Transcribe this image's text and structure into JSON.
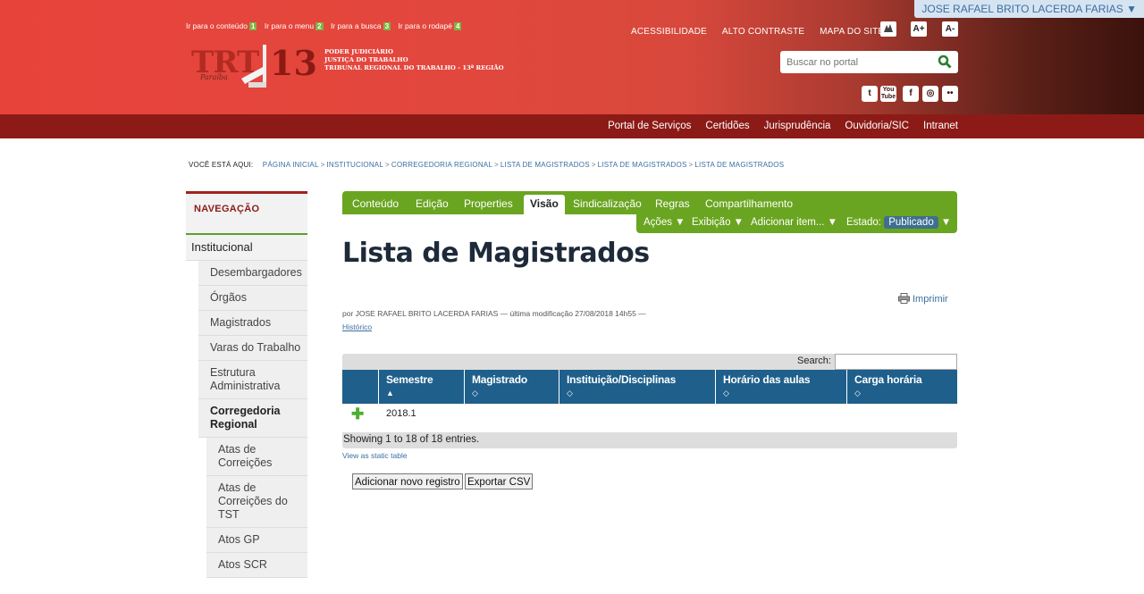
{
  "user": {
    "name": "JOSE RAFAEL BRITO LACERDA FARIAS ▼"
  },
  "skip_links": [
    {
      "label": "Ir para o conteúdo",
      "key": "1"
    },
    {
      "label": "Ir para o menu",
      "key": "2"
    },
    {
      "label": "Ir para a busca",
      "key": "3"
    },
    {
      "label": "Ir para o rodapé",
      "key": "4"
    }
  ],
  "logo": {
    "text": "TRT",
    "number": "13",
    "subtitle": "Paraíba"
  },
  "institution": [
    "PODER JUDICIÁRIO",
    "JUSTIÇA DO TRABALHO",
    "TRIBUNAL REGIONAL DO TRABALHO - 13ª REGIÃO"
  ],
  "top_links": [
    "ACESSIBILIDADE",
    "ALTO CONTRASTE",
    "MAPA DO SITE"
  ],
  "font_buttons": [
    "A+",
    "A-"
  ],
  "search": {
    "placeholder": "Buscar no portal"
  },
  "social_icons": [
    "twitter-icon",
    "youtube-icon",
    "facebook-icon",
    "instagram-icon",
    "flickr-icon"
  ],
  "service_links": [
    "Portal de Serviços",
    "Certidões",
    "Jurisprudência",
    "Ouvidoria/SIC",
    "Intranet"
  ],
  "breadcrumb": {
    "label": "VOCÊ ESTÁ AQUI:",
    "items": [
      "PÁGINA INICIAL",
      "INSTITUCIONAL",
      "CORREGEDORIA REGIONAL",
      "LISTA DE MAGISTRADOS",
      "LISTA DE MAGISTRADOS",
      "LISTA DE MAGISTRADOS"
    ],
    "separator": ">"
  },
  "nav": {
    "heading": "NAVEGAÇÃO",
    "top": "Institucional",
    "items": [
      "Desembargadores",
      "Órgãos",
      "Magistrados",
      "Varas do Trabalho",
      "Estrutura Administrativa",
      "Corregedoria Regional"
    ],
    "sub_items": [
      "Atas de Correições",
      "Atas de Correições do TST",
      "Atos GP",
      "Atos SCR"
    ]
  },
  "edit_tabs": [
    "Conteúdo",
    "Edição",
    "Properties",
    "Visão",
    "Sindicalização",
    "Regras",
    "Compartilhamento"
  ],
  "actions": {
    "acoes": "Ações ▼",
    "exibicao": "Exibição ▼",
    "adicionar": "Adicionar item... ▼",
    "estado_label": "Estado:",
    "estado_value": "Publicado",
    "estado_arrow": "▼"
  },
  "page": {
    "title": "Lista de Magistrados",
    "print": "Imprimir",
    "byline": "por JOSE RAFAEL BRITO LACERDA FARIAS — última modificação 27/08/2018 14h55 —",
    "history": "Histórico"
  },
  "table": {
    "search_label": "Search:",
    "columns": [
      "Semestre",
      "Magistrado",
      "Instituição/Disciplinas",
      "Horário das aulas",
      "Carga horária"
    ],
    "sort_asc": "▲",
    "sort_both": "◇",
    "rows": [
      [
        "2018.1"
      ]
    ],
    "footer": "Showing 1 to 18 of 18 entries.",
    "static_link": "View as static table"
  },
  "buttons": {
    "add": "Adicionar novo registro",
    "export": "Exportar CSV"
  },
  "colors": {
    "header_red": "#e8433b",
    "dark_red": "#8c1b17",
    "green": "#6aa521",
    "table_blue": "#1f5f8b",
    "link_blue": "#3b6fa0"
  }
}
